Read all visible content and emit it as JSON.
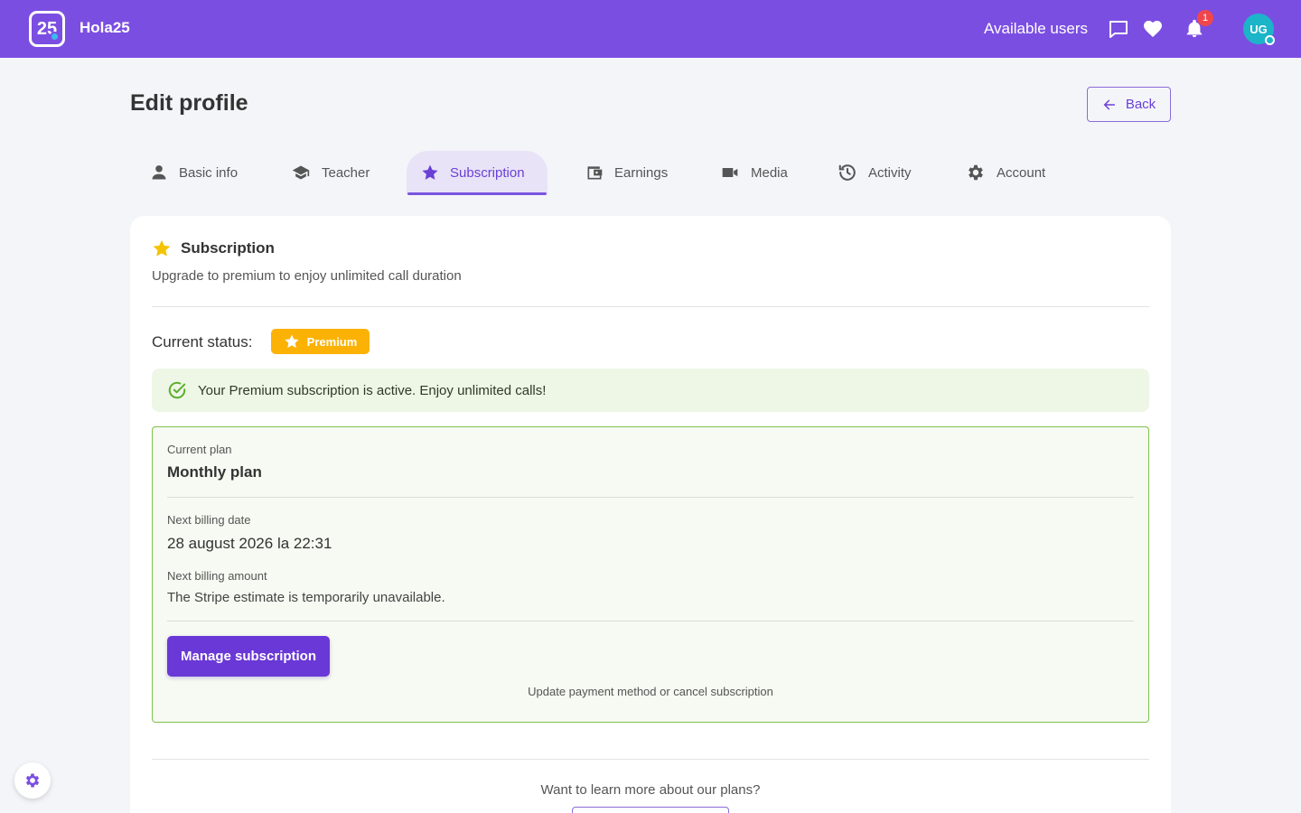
{
  "header": {
    "logo_text": "25",
    "brand": "Hola25",
    "nav_link": "Available users",
    "notification_count": "1",
    "avatar_initials": "UG",
    "accent_color": "#7b4ee2"
  },
  "page": {
    "title": "Edit profile",
    "back_label": "Back"
  },
  "tabs": [
    {
      "label": "Basic info",
      "icon": "person-icon"
    },
    {
      "label": "Teacher",
      "icon": "graduation-cap-icon"
    },
    {
      "label": "Subscription",
      "icon": "star-icon",
      "active": true
    },
    {
      "label": "Earnings",
      "icon": "wallet-icon"
    },
    {
      "label": "Media",
      "icon": "video-camera-icon"
    },
    {
      "label": "Activity",
      "icon": "history-icon"
    },
    {
      "label": "Account",
      "icon": "gear-icon"
    }
  ],
  "subscription": {
    "title": "Subscription",
    "subtitle": "Upgrade to premium to enjoy unlimited call duration",
    "status_label": "Current status:",
    "status_badge": "Premium",
    "alert_text": "Your Premium subscription is active. Enjoy unlimited calls!",
    "current_plan_label": "Current plan",
    "current_plan_value": "Monthly plan",
    "next_billing_date_label": "Next billing date",
    "next_billing_date_value": "28 august 2026 la 22:31",
    "next_billing_amount_label": "Next billing amount",
    "next_billing_amount_value": "The Stripe estimate is temporarily unavailable.",
    "manage_button": "Manage subscription",
    "manage_help": "Update payment method or cancel subscription",
    "learn_more": "Want to learn more about our plans?"
  }
}
